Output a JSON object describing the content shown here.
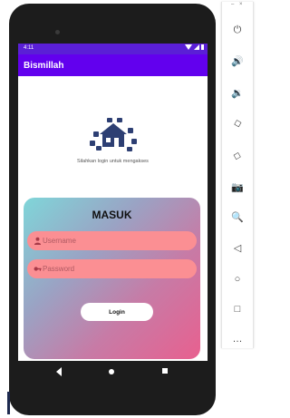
{
  "status_bar": {
    "time": "4:11"
  },
  "app_bar": {
    "title": "Bismillah"
  },
  "header": {
    "tagline": "Silahkan login untuk mengakses"
  },
  "login_card": {
    "title": "MASUK",
    "username": {
      "placeholder": "Username",
      "value": ""
    },
    "password": {
      "placeholder": "Password",
      "value": ""
    },
    "login_label": "Login"
  },
  "emulator_toolbar": {
    "window_controls": "– ×",
    "buttons": [
      {
        "name": "power",
        "glyph": "⏻"
      },
      {
        "name": "volume-up",
        "glyph": "🔊"
      },
      {
        "name": "volume-down",
        "glyph": "🔉"
      },
      {
        "name": "rotate-left",
        "glyph": "◇"
      },
      {
        "name": "rotate-right",
        "glyph": "◇"
      },
      {
        "name": "screenshot",
        "glyph": "📷"
      },
      {
        "name": "zoom",
        "glyph": "🔍"
      },
      {
        "name": "back",
        "glyph": "◁"
      },
      {
        "name": "home",
        "glyph": "○"
      },
      {
        "name": "overview",
        "glyph": "□"
      },
      {
        "name": "more",
        "glyph": "…"
      }
    ]
  },
  "colors": {
    "status_bar": "#5a1fd6",
    "app_bar": "#6200ee",
    "input_fill": "#fb8f93",
    "card_gradient_start": "#7fd6d9",
    "card_gradient_end": "#e8608f",
    "logo_blue": "#2d3f73"
  }
}
